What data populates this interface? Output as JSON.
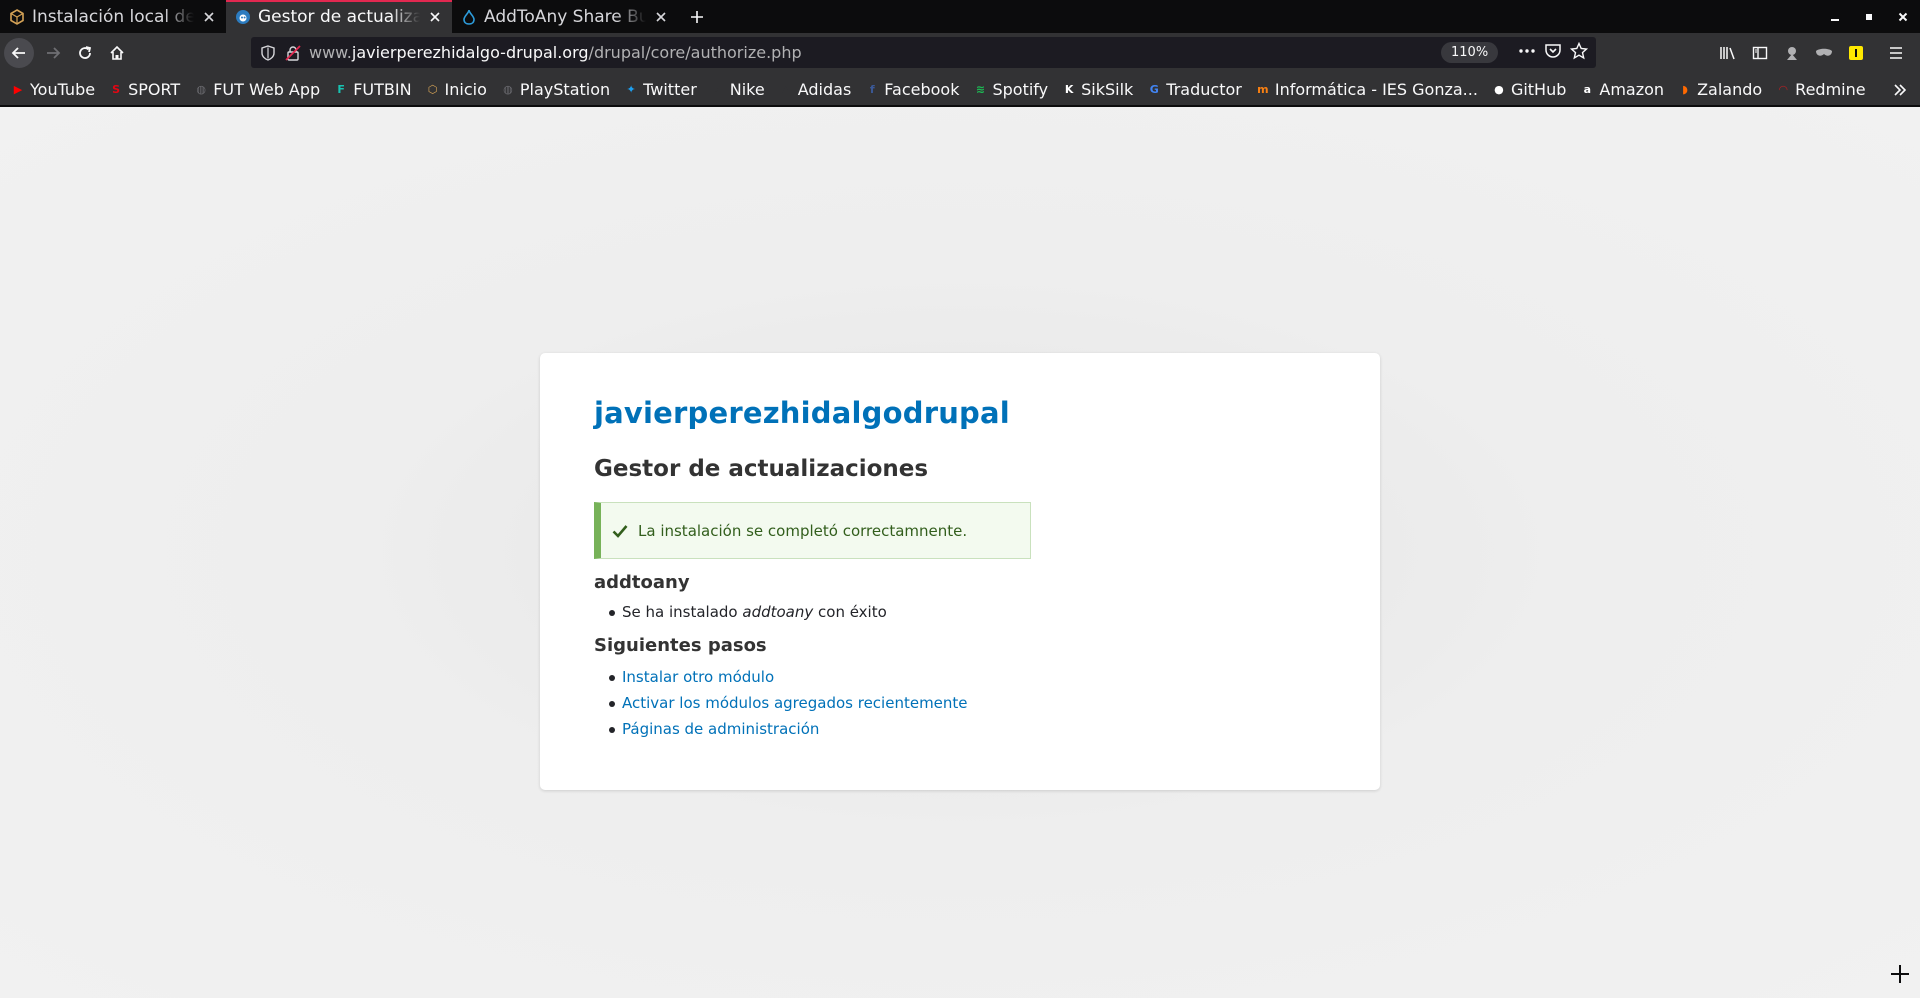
{
  "browser": {
    "tabs": [
      {
        "title": "Instalación local de un",
        "favicon": "drupal-cube-icon",
        "active": false
      },
      {
        "title": "Gestor de actualizaciones",
        "favicon": "drupal-icon",
        "active": true
      },
      {
        "title": "AddToAny Share Buttons",
        "favicon": "drupal-drop-icon",
        "active": false
      }
    ],
    "url": {
      "prefix": "www.",
      "host": "javierperezhidalgo-drupal.org",
      "path": "/drupal/core/authorize.php"
    },
    "zoom": "110%",
    "bookmarks": [
      {
        "label": "YouTube",
        "icon": "youtube-icon",
        "color": "#ff0000",
        "glyph": "▶"
      },
      {
        "label": "SPORT",
        "icon": "sport-icon",
        "color": "#e30613",
        "glyph": "S"
      },
      {
        "label": "FUT Web App",
        "icon": "globe-icon",
        "color": "#6b6b70",
        "glyph": "◍"
      },
      {
        "label": "FUTBIN",
        "icon": "futbin-icon",
        "color": "#17c3b2",
        "glyph": "F"
      },
      {
        "label": "Inicio",
        "icon": "drupal-cube-icon",
        "color": "#d4a256",
        "glyph": "⬡"
      },
      {
        "label": "PlayStation",
        "icon": "globe-icon",
        "color": "#6b6b70",
        "glyph": "◍"
      },
      {
        "label": "Twitter",
        "icon": "twitter-icon",
        "color": "#1da1f2",
        "glyph": "✦"
      },
      {
        "label": "Nike",
        "icon": "nike-icon",
        "color": "#323234",
        "glyph": "✓"
      },
      {
        "label": "Adidas",
        "icon": "adidas-icon",
        "color": "#323234",
        "glyph": "▲"
      },
      {
        "label": "Facebook",
        "icon": "facebook-icon",
        "color": "#3b5998",
        "glyph": "f"
      },
      {
        "label": "Spotify",
        "icon": "spotify-icon",
        "color": "#1db954",
        "glyph": "≋"
      },
      {
        "label": "SikSilk",
        "icon": "siksilk-icon",
        "color": "#ffffff",
        "glyph": "K"
      },
      {
        "label": "Traductor",
        "icon": "translate-icon",
        "color": "#4285f4",
        "glyph": "G"
      },
      {
        "label": "Informática - IES Gonza...",
        "icon": "moodle-icon",
        "color": "#f98012",
        "glyph": "m"
      },
      {
        "label": "GitHub",
        "icon": "github-icon",
        "color": "#ffffff",
        "glyph": "●"
      },
      {
        "label": "Amazon",
        "icon": "amazon-icon",
        "color": "#ffffff",
        "glyph": "a"
      },
      {
        "label": "Zalando",
        "icon": "zalando-icon",
        "color": "#ff6900",
        "glyph": "◗"
      },
      {
        "label": "Redmine",
        "icon": "redmine-icon",
        "color": "#b32024",
        "glyph": "◠"
      }
    ]
  },
  "page": {
    "site_name": "javierperezhidalgodrupal",
    "title": "Gestor de actualizaciones",
    "status_message": "La instalación se completó correctamnente.",
    "module_heading": "addtoany",
    "installed_item": {
      "prefix": "Se ha instalado ",
      "module": "addtoany",
      "suffix": " con éxito"
    },
    "next_steps_heading": "Siguientes pasos",
    "next_steps": [
      "Instalar otro módulo",
      "Activar los módulos agregados recientemente",
      "Páginas de administración"
    ]
  },
  "colors": {
    "link": "#0071b8",
    "status_bar": "#77b259",
    "active_tab_line": "#e22850"
  }
}
